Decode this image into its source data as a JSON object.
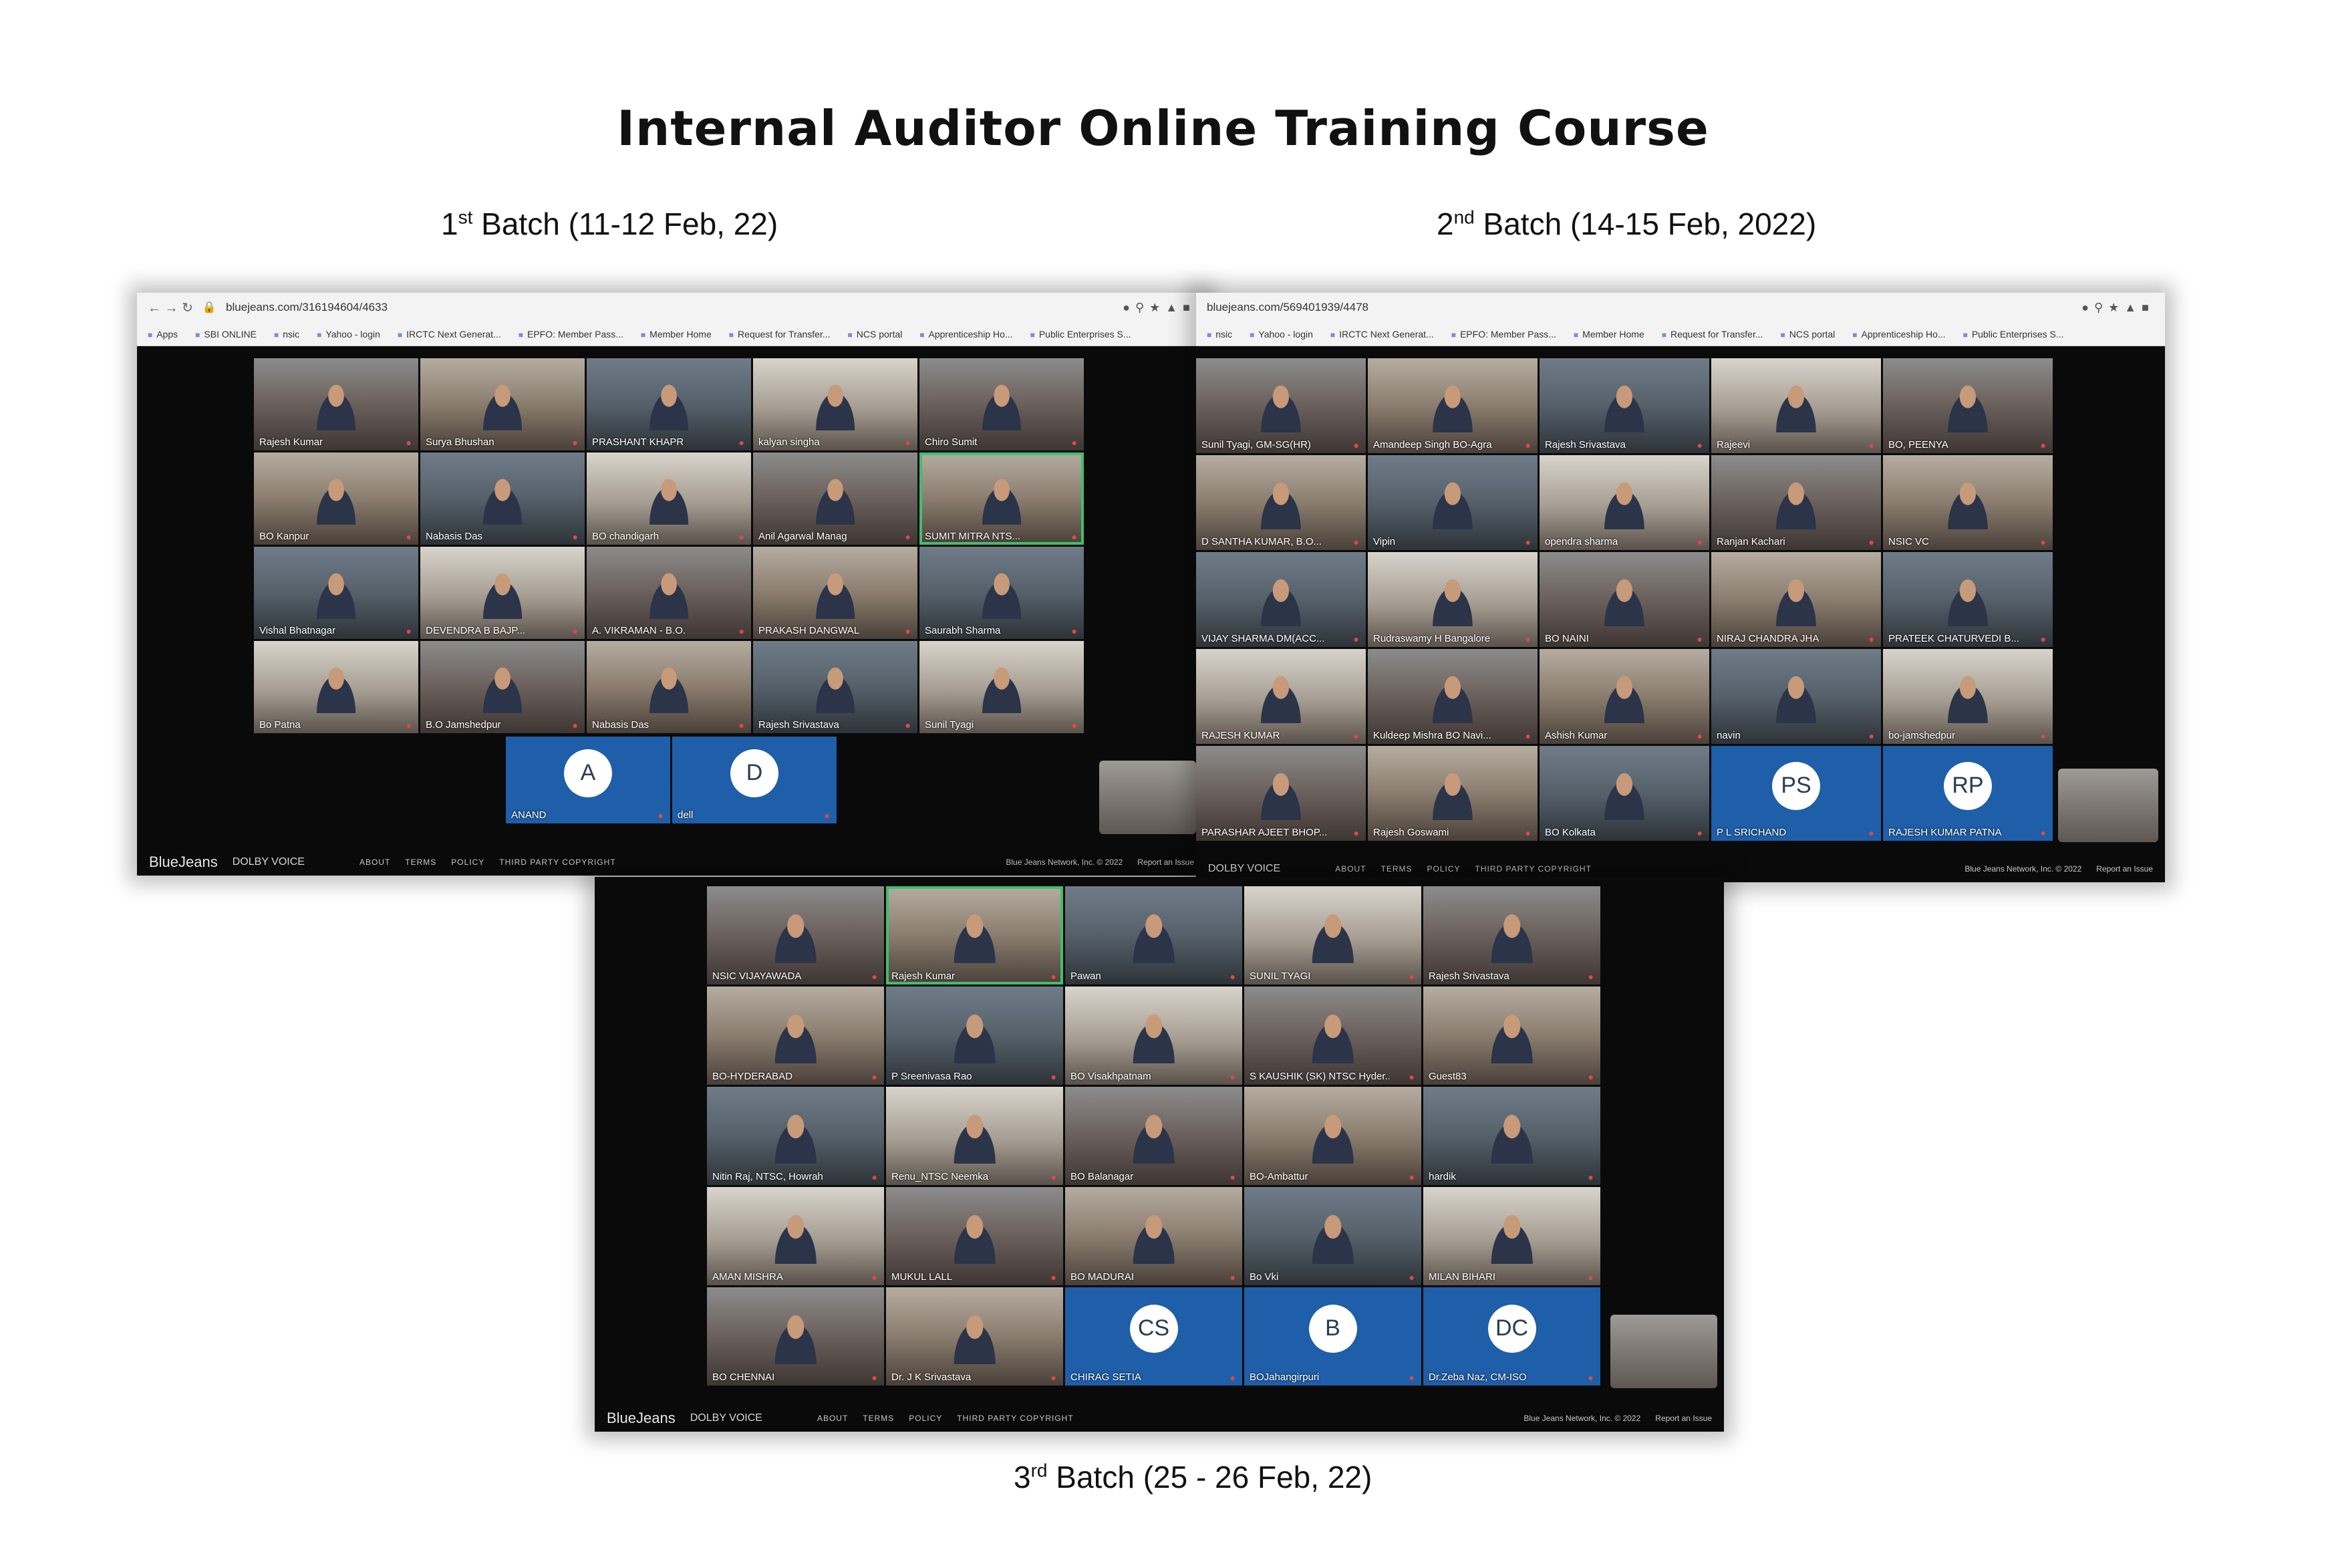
{
  "page": {
    "title": "Internal Auditor Online Training Course"
  },
  "batches": [
    {
      "ordinal": "1",
      "suffix": "st",
      "label": "Batch (11-12 Feb, 22)"
    },
    {
      "ordinal": "2",
      "suffix": "nd",
      "label": "Batch (14-15 Feb, 2022)"
    },
    {
      "ordinal": "3",
      "suffix": "rd",
      "label": "Batch (25 - 26 Feb, 22)"
    }
  ],
  "common": {
    "brand": "BlueJeans",
    "dolby": "DOLBY VOICE",
    "footer_links": [
      "ABOUT",
      "TERMS",
      "POLICY",
      "THIRD PARTY COPYRIGHT"
    ],
    "copyright": "Blue Jeans Network, Inc. © 2022",
    "report": "Report an Issue"
  },
  "shot1": {
    "url": "bluejeans.com/316194604/4633",
    "bookmarks": [
      "Apps",
      "SBI ONLINE",
      "nsic",
      "Yahoo - login",
      "IRCTC Next Generat...",
      "EPFO: Member Pass...",
      "Member Home",
      "Request for Transfer...",
      "NCS portal",
      "Apprenticeship Ho...",
      "Public Enterprises S..."
    ],
    "tiles": [
      {
        "name": "Rajesh Kumar"
      },
      {
        "name": "Surya Bhushan"
      },
      {
        "name": "PRASHANT KHAPR"
      },
      {
        "name": "kalyan singha"
      },
      {
        "name": "Chiro Sumit"
      },
      {
        "name": "BO Kanpur"
      },
      {
        "name": "Nabasis Das"
      },
      {
        "name": "BO chandigarh"
      },
      {
        "name": "Anil Agarwal Manag"
      },
      {
        "name": "SUMIT MITRA NTS..."
      },
      {
        "name": "Vishal Bhatnagar"
      },
      {
        "name": "DEVENDRA B BAJP..."
      },
      {
        "name": "A. VIKRAMAN - B.O."
      },
      {
        "name": "PRAKASH DANGWAL"
      },
      {
        "name": "Saurabh Sharma"
      },
      {
        "name": "Bo Patna"
      },
      {
        "name": "B.O Jamshedpur"
      },
      {
        "name": "Nabasis Das"
      },
      {
        "name": "Rajesh Srivastava"
      },
      {
        "name": "Sunil Tyagi"
      }
    ],
    "avatars": [
      {
        "initial": "A",
        "name": "ANAND"
      },
      {
        "initial": "D",
        "name": "dell"
      }
    ]
  },
  "shot2": {
    "url": "bluejeans.com/569401939/4478",
    "bookmarks": [
      "nsic",
      "Yahoo - login",
      "IRCTC Next Generat...",
      "EPFO: Member Pass...",
      "Member Home",
      "Request for Transfer...",
      "NCS portal",
      "Apprenticeship Ho...",
      "Public Enterprises S..."
    ],
    "tiles": [
      {
        "name": "Sunil Tyagi, GM-SG(HR)"
      },
      {
        "name": "Amandeep Singh BO-Agra"
      },
      {
        "name": "Rajesh Srivastava"
      },
      {
        "name": "Rajeevi"
      },
      {
        "name": "BO, PEENYA"
      },
      {
        "name": "D SANTHA KUMAR, B.O..."
      },
      {
        "name": "Vipin"
      },
      {
        "name": "opendra sharma"
      },
      {
        "name": "Ranjan Kachari"
      },
      {
        "name": "NSIC VC"
      },
      {
        "name": "VIJAY SHARMA DM(ACC..."
      },
      {
        "name": "Rudraswamy H Bangalore"
      },
      {
        "name": "BO NAINI"
      },
      {
        "name": "NIRAJ CHANDRA JHA"
      },
      {
        "name": "PRATEEK CHATURVEDI B..."
      },
      {
        "name": "RAJESH KUMAR"
      },
      {
        "name": "Kuldeep Mishra BO Navi..."
      },
      {
        "name": "Ashish Kumar"
      },
      {
        "name": "navin"
      },
      {
        "name": "bo-jamshedpur"
      },
      {
        "name": "PARASHAR AJEET BHOP..."
      },
      {
        "name": "Rajesh Goswami"
      },
      {
        "name": "BO Kolkata"
      }
    ],
    "avatars": [
      {
        "initial": "PS",
        "name": "P L SRICHAND"
      },
      {
        "initial": "RP",
        "name": "RAJESH KUMAR PATNA"
      }
    ]
  },
  "shot3": {
    "tiles": [
      {
        "name": "NSIC VIJAYAWADA"
      },
      {
        "name": "Rajesh Kumar"
      },
      {
        "name": "Pawan"
      },
      {
        "name": "SUNIL TYAGI"
      },
      {
        "name": "Rajesh Srivastava"
      },
      {
        "name": "BO-HYDERABAD"
      },
      {
        "name": "P Sreenivasa Rao"
      },
      {
        "name": "BO Visakhpatnam"
      },
      {
        "name": "S KAUSHIK (SK) NTSC Hyder..."
      },
      {
        "name": "Guest83"
      },
      {
        "name": "Nitin Raj, NTSC, Howrah"
      },
      {
        "name": "Renu_NTSC Neemka"
      },
      {
        "name": "BO Balanagar"
      },
      {
        "name": "BO-Ambattur"
      },
      {
        "name": "hardik"
      },
      {
        "name": "AMAN MISHRA"
      },
      {
        "name": "MUKUL LALL"
      },
      {
        "name": "BO MADURAI"
      },
      {
        "name": "Bo Vki"
      },
      {
        "name": "MILAN BIHARI"
      },
      {
        "name": "BO CHENNAI"
      },
      {
        "name": "Dr. J K Srivastava"
      }
    ],
    "avatars": [
      {
        "initial": "CS",
        "name": "CHIRAG SETIA"
      },
      {
        "initial": "B",
        "name": "BOJahangirpuri"
      },
      {
        "initial": "DC",
        "name": "Dr.Zeba Naz, CM-ISO"
      }
    ]
  }
}
